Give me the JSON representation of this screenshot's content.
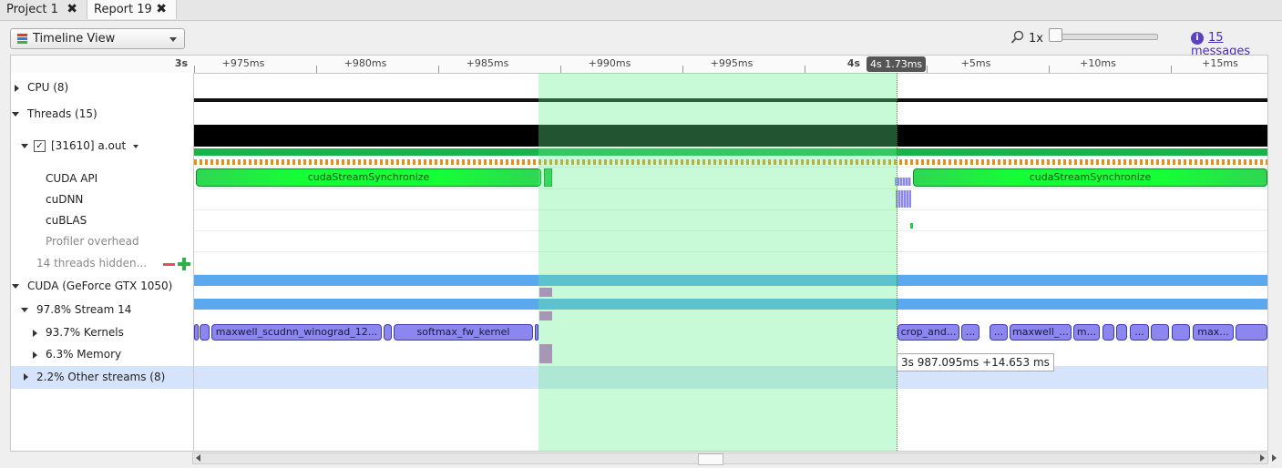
{
  "tabs": [
    {
      "label": "Project 1",
      "close": "✖"
    },
    {
      "label": "Report 19",
      "close": "✖"
    }
  ],
  "toolbar": {
    "view_label": "Timeline View",
    "zoom_label": "1x",
    "zoom_level": 0,
    "messages_icon": "i",
    "messages_label": "15 messages"
  },
  "ruler": {
    "ticks": [
      "3s",
      "+975ms",
      "+980ms",
      "+985ms",
      "+990ms",
      "+995ms",
      "4s",
      "+5ms",
      "+10ms",
      "+15ms"
    ],
    "cursor_label": "4s 1.73ms"
  },
  "tree": {
    "cpu": "CPU (8)",
    "threads": "Threads (15)",
    "process": "[31610] a.out",
    "process_checked": "✓",
    "cuda_api": "CUDA API",
    "cudnn": "cuDNN",
    "cublas": "cuBLAS",
    "profiler_overhead": "Profiler overhead",
    "hidden_threads": "14 threads hidden...",
    "cuda_device": "CUDA (GeForce GTX 1050)",
    "stream": "97.8% Stream 14",
    "kernels": "93.7% Kernels",
    "memory": "6.3% Memory",
    "other_streams": "2.2% Other streams (8)"
  },
  "timeline": {
    "api_left": "cudaStreamSynchronize",
    "api_right": "cudaStreamSynchronize",
    "kernels": [
      "maxwell_scudnn_winograd_12...",
      "softmax_fw_kernel",
      "crop_and...",
      "...",
      "...",
      "maxwell_...",
      "m...",
      "...",
      "max..."
    ],
    "tooltip": "3s 987.095ms +14.653 ms"
  },
  "colors": {
    "selection": "#64f08c",
    "kernel": "#8b87ee",
    "api": "#14ff36",
    "memory": "#5aa9ee",
    "accent": "#4a2cc4"
  }
}
